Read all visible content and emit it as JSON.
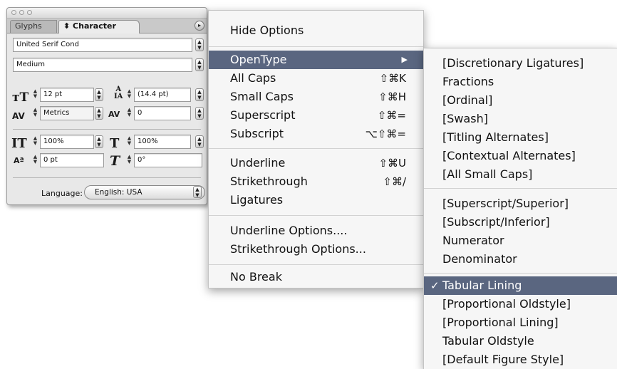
{
  "panel": {
    "tabs": {
      "glyphs": "Glyphs",
      "character": "⬍ Character"
    },
    "font_family": "United Serif Cond",
    "font_style": "Medium",
    "font_size": "12 pt",
    "leading": "(14.4 pt)",
    "kerning": "Metrics",
    "tracking": "0",
    "vertical_scale": "100%",
    "horizontal_scale": "100%",
    "baseline_shift": "0 pt",
    "skew": "0°",
    "language_label": "Language:",
    "language_value": "English: USA"
  },
  "menu": {
    "hide_options": "Hide Options",
    "opentype": "OpenType",
    "all_caps": "All Caps",
    "all_caps_key": "⇧⌘K",
    "small_caps": "Small Caps",
    "small_caps_key": "⇧⌘H",
    "superscript": "Superscript",
    "superscript_key": "⇧⌘=",
    "subscript": "Subscript",
    "subscript_key": "⌥⇧⌘=",
    "underline": "Underline",
    "underline_key": "⇧⌘U",
    "strikethrough": "Strikethrough",
    "strikethrough_key": "⇧⌘/",
    "ligatures": "Ligatures",
    "underline_options": "Underline Options....",
    "strikethrough_options": "Strikethrough Options...",
    "no_break": "No Break"
  },
  "submenu": {
    "discretionary_ligatures": "[Discretionary Ligatures]",
    "fractions": "Fractions",
    "ordinal": "[Ordinal]",
    "swash": "[Swash]",
    "titling_alternates": "[Titling Alternates]",
    "contextual_alternates": "[Contextual Alternates]",
    "all_small_caps": "[All Small Caps]",
    "superscript_superior": "[Superscript/Superior]",
    "subscript_inferior": "[Subscript/Inferior]",
    "numerator": "Numerator",
    "denominator": "Denominator",
    "tabular_lining": "Tabular Lining",
    "proportional_oldstyle": "[Proportional Oldstyle]",
    "proportional_lining": "[Proportional Lining]",
    "tabular_oldstyle": "Tabular Oldstyle",
    "default_figure_style": "[Default Figure Style]"
  },
  "colors": {
    "highlight": "#5a6680"
  }
}
